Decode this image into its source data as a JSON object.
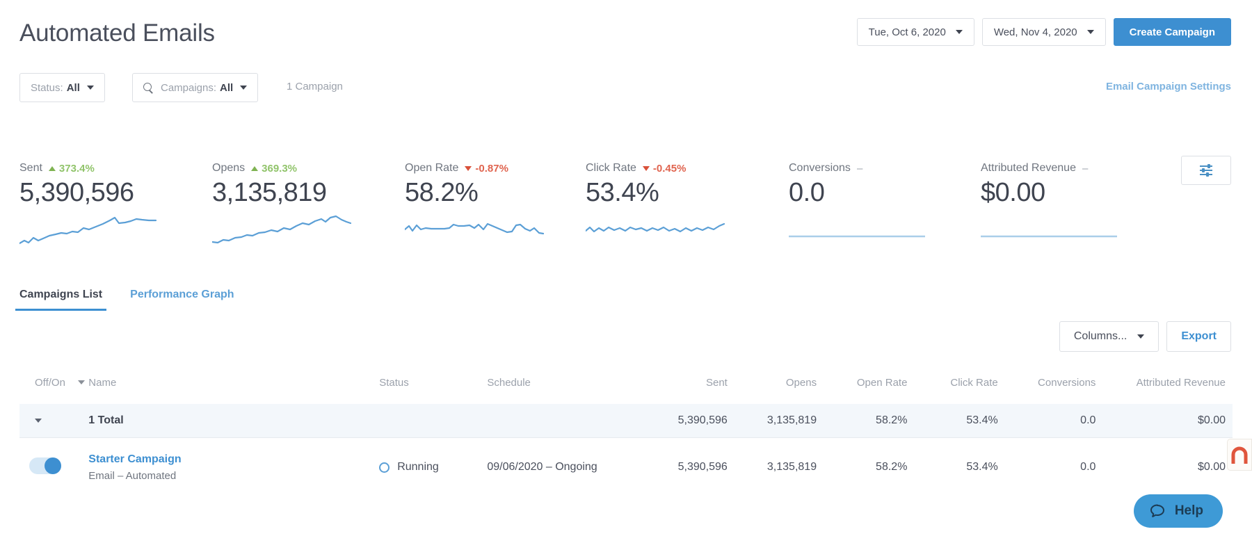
{
  "header": {
    "title": "Automated Emails",
    "date_start": "Tue, Oct 6, 2020",
    "date_end": "Wed, Nov 4, 2020",
    "create_button": "Create Campaign"
  },
  "filters": {
    "status_label": "Status:",
    "status_value": "All",
    "campaigns_label": "Campaigns:",
    "campaigns_value": "All",
    "count": "1 Campaign",
    "settings_link": "Email Campaign Settings"
  },
  "kpis": [
    {
      "label": "Sent",
      "delta": "373.4%",
      "direction": "up",
      "value": "5,390,596"
    },
    {
      "label": "Opens",
      "delta": "369.3%",
      "direction": "up",
      "value": "3,135,819"
    },
    {
      "label": "Open Rate",
      "delta": "-0.87%",
      "direction": "down",
      "value": "58.2%"
    },
    {
      "label": "Click Rate",
      "delta": "-0.45%",
      "direction": "down",
      "value": "53.4%"
    },
    {
      "label": "Conversions",
      "delta": "–",
      "direction": "none",
      "value": "0.0"
    },
    {
      "label": "Attributed Revenue",
      "delta": "–",
      "direction": "none",
      "value": "$0.00"
    }
  ],
  "tabs": [
    {
      "label": "Campaigns List",
      "active": true
    },
    {
      "label": "Performance Graph",
      "active": false
    }
  ],
  "table_toolbar": {
    "columns_label": "Columns...",
    "export_label": "Export"
  },
  "table": {
    "columns": [
      "Off/On",
      "Name",
      "Status",
      "Schedule",
      "Sent",
      "Opens",
      "Open Rate",
      "Click Rate",
      "Conversions",
      "Attributed Revenue"
    ],
    "total_row": {
      "name": "1 Total",
      "sent": "5,390,596",
      "opens": "3,135,819",
      "open_rate": "58.2%",
      "click_rate": "53.4%",
      "conversions": "0.0",
      "revenue": "$0.00"
    },
    "rows": [
      {
        "name": "Starter Campaign",
        "subtitle": "Email – Automated",
        "status": "Running",
        "schedule": "09/06/2020 – Ongoing",
        "sent": "5,390,596",
        "opens": "3,135,819",
        "open_rate": "58.2%",
        "click_rate": "53.4%",
        "conversions": "0.0",
        "revenue": "$0.00"
      }
    ]
  },
  "widgets": {
    "help_label": "Help"
  },
  "colors": {
    "accent": "#3d8fd1",
    "link": "#3d8fd1",
    "up": "#91c46b",
    "down": "#e0644f",
    "muted": "#9ba1ab",
    "total_row_bg": "#f3f7fb"
  }
}
